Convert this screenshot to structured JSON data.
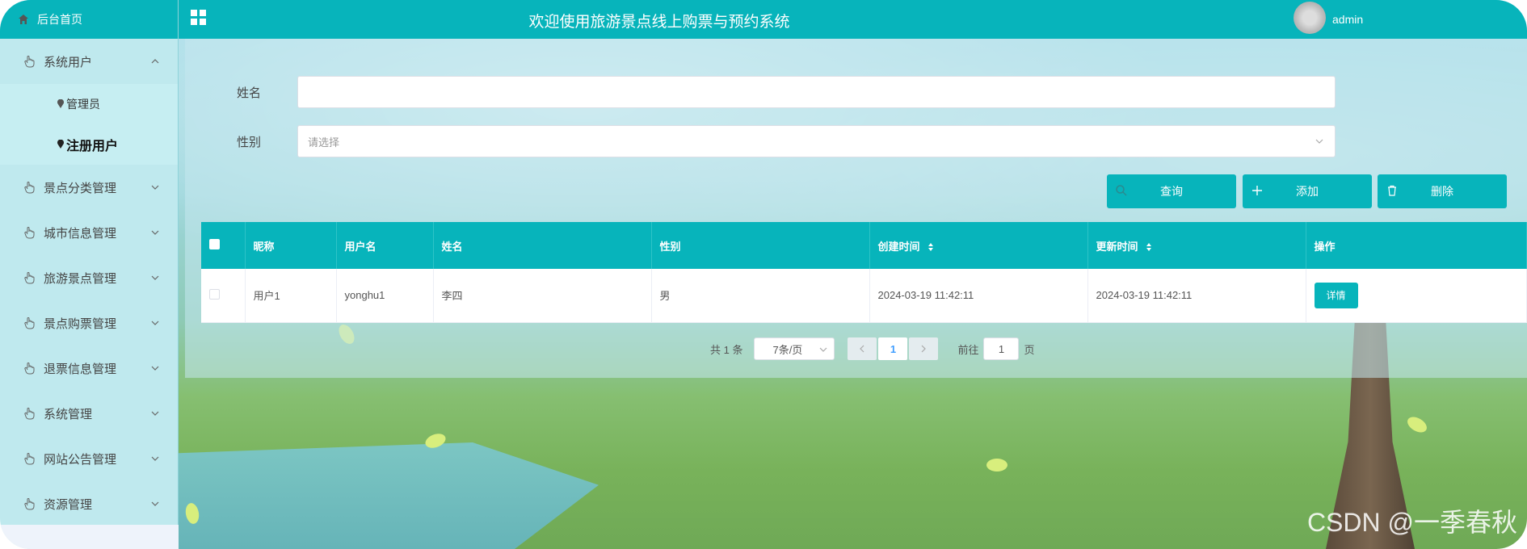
{
  "colors": {
    "accent": "#07b4bb",
    "sidebar_bg": "#bfe9ee"
  },
  "sidebar": {
    "home_label": "后台首页",
    "menus": [
      {
        "label": "系统用户",
        "expanded": true,
        "children": [
          {
            "label": "管理员",
            "active": false
          },
          {
            "label": "注册用户",
            "active": true
          }
        ]
      },
      {
        "label": "景点分类管理"
      },
      {
        "label": "城市信息管理"
      },
      {
        "label": "旅游景点管理"
      },
      {
        "label": "景点购票管理"
      },
      {
        "label": "退票信息管理"
      },
      {
        "label": "系统管理"
      },
      {
        "label": "网站公告管理"
      },
      {
        "label": "资源管理"
      }
    ]
  },
  "header": {
    "title": "欢迎使用旅游景点线上购票与预约系统",
    "user": "admin"
  },
  "search": {
    "name_label": "姓名",
    "name_value": "",
    "gender_label": "性别",
    "gender_placeholder": "请选择"
  },
  "actions": {
    "query": "查询",
    "add": "添加",
    "delete": "删除"
  },
  "table": {
    "columns": [
      "昵称",
      "用户名",
      "姓名",
      "性别",
      "创建时间",
      "更新时间",
      "操作"
    ],
    "rows": [
      {
        "nickname": "用户1",
        "username": "yonghu1",
        "name": "李四",
        "gender": "男",
        "created": "2024-03-19 11:42:11",
        "updated": "2024-03-19 11:42:11",
        "action": "详情"
      }
    ]
  },
  "pagination": {
    "total": "共 1 条",
    "page_size": "7条/页",
    "current_page": "1",
    "goto_label": "前往",
    "goto_value": "1",
    "goto_suffix": "页"
  },
  "watermark": "CSDN @一季春秋"
}
